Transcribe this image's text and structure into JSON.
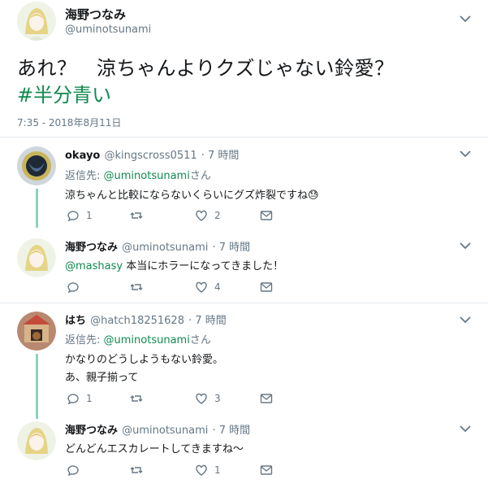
{
  "main_tweet": {
    "display_name": "海野つなみ",
    "handle": "@uminotsunami",
    "text": "あれ？　涼ちゃんよりクズじゃない鈴愛？",
    "hashtag": "#半分青い",
    "timestamp": "7:35 - 2018年8月11日"
  },
  "replies": [
    {
      "display_name": "okayo",
      "handle": "@kingscross0511",
      "time": "· 7 時間",
      "reply_prefix": "返信先: ",
      "reply_to": "@uminotsunami",
      "reply_suffix": "さん",
      "text": "涼ちゃんと比較にならないくらいにグズ炸裂ですね",
      "emoji": "😓",
      "counts": {
        "reply": "1",
        "retweet": "",
        "like": "2"
      }
    },
    {
      "display_name": "海野つなみ",
      "handle": "@uminotsunami",
      "time": "· 7 時間",
      "mention": "@mashasy",
      "text": " 本当にホラーになってきました！",
      "counts": {
        "reply": "",
        "retweet": "",
        "like": "4"
      }
    },
    {
      "display_name": "はち",
      "handle": "@hatch18251628",
      "time": "· 7 時間",
      "reply_prefix": "返信先: ",
      "reply_to": "@uminotsunami",
      "reply_suffix": "さん",
      "text_line1": "かなりのどうしようもない鈴愛。",
      "text_line2": "あ、親子揃って",
      "counts": {
        "reply": "1",
        "retweet": "",
        "like": "3"
      }
    },
    {
      "display_name": "海野つなみ",
      "handle": "@uminotsunami",
      "time": "· 7 時間",
      "text": "どんどんエスカレートしてきますね〜",
      "counts": {
        "reply": "",
        "retweet": "",
        "like": "1"
      }
    }
  ],
  "icons": [
    "chevron-down-icon",
    "reply-icon",
    "retweet-icon",
    "like-icon",
    "dm-icon"
  ],
  "colors": {
    "link": "#0f8a4f",
    "thread_line": "#8fd0c1",
    "muted": "#657786"
  }
}
